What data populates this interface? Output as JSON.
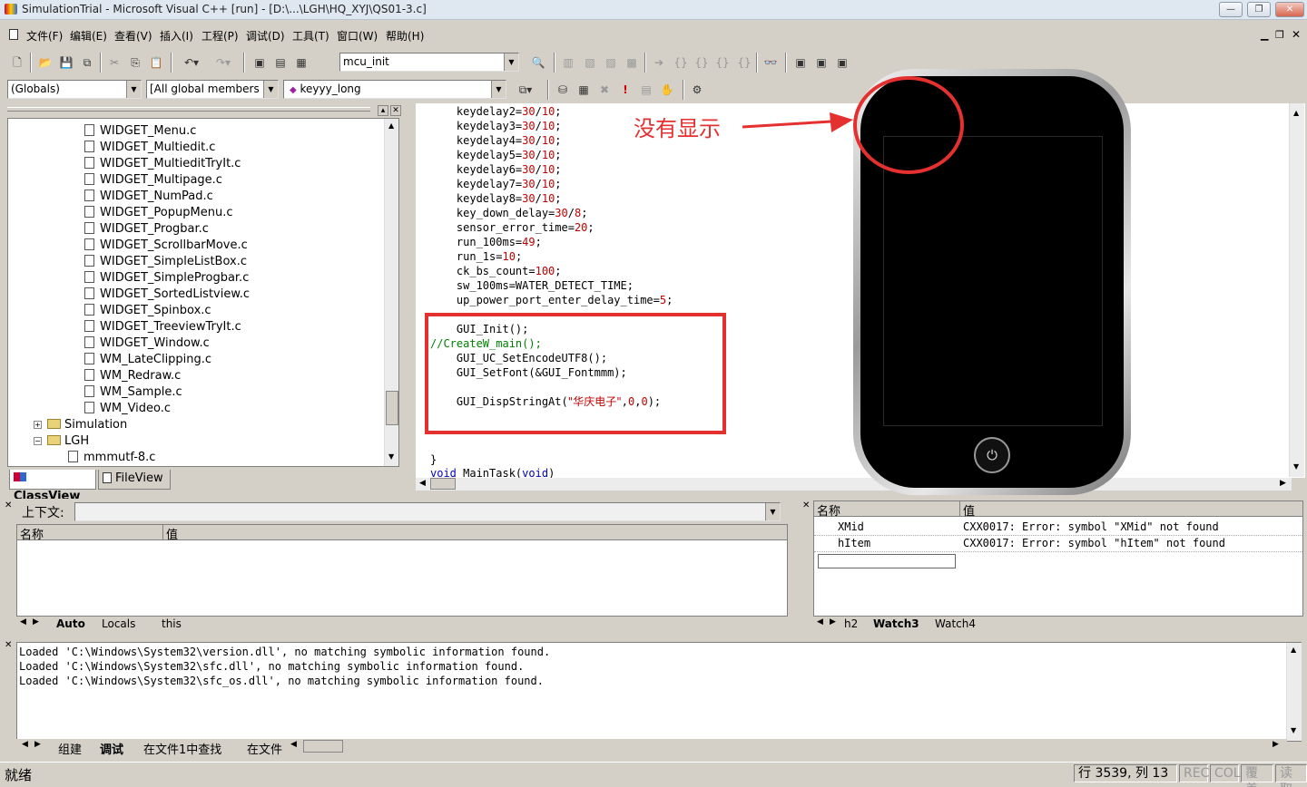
{
  "window": {
    "title": "SimulationTrial - Microsoft Visual C++ [run] - [D:\\...\\LGH\\HQ_XYJ\\QS01-3.c]",
    "min_label": "—",
    "max_label": "❐",
    "close_label": "✕"
  },
  "menu": [
    "文件(F)",
    "编辑(E)",
    "查看(V)",
    "插入(I)",
    "工程(P)",
    "调试(D)",
    "工具(T)",
    "窗口(W)",
    "帮助(H)"
  ],
  "toolbar": {
    "function_combo": "mcu_init",
    "globals_combo": "(Globals)",
    "members_combo": "[All global members",
    "symbol_combo": "keyyy_long"
  },
  "tree": {
    "files": [
      "WIDGET_Menu.c",
      "WIDGET_Multiedit.c",
      "WIDGET_MultieditTryIt.c",
      "WIDGET_Multipage.c",
      "WIDGET_NumPad.c",
      "WIDGET_PopupMenu.c",
      "WIDGET_Progbar.c",
      "WIDGET_ScrollbarMove.c",
      "WIDGET_SimpleListBox.c",
      "WIDGET_SimpleProgbar.c",
      "WIDGET_SortedListview.c",
      "WIDGET_Spinbox.c",
      "WIDGET_TreeviewTryIt.c",
      "WIDGET_Window.c",
      "WM_LateClipping.c",
      "WM_Redraw.c",
      "WM_Sample.c",
      "WM_Video.c"
    ],
    "folder_simulation": "Simulation",
    "folder_lgh": "LGH",
    "file_lgh": "mmmutf-8.c",
    "tab_classview": "ClassView",
    "tab_fileview": "FileView"
  },
  "code": {
    "l1": [
      "    keydelay2=",
      "30",
      "/",
      "10",
      ";"
    ],
    "l2": [
      "    keydelay3=",
      "30",
      "/",
      "10",
      ";"
    ],
    "l3": [
      "    keydelay4=",
      "30",
      "/",
      "10",
      ";"
    ],
    "l4": [
      "    keydelay5=",
      "30",
      "/",
      "10",
      ";"
    ],
    "l5": [
      "    keydelay6=",
      "30",
      "/",
      "10",
      ";"
    ],
    "l6": [
      "    keydelay7=",
      "30",
      "/",
      "10",
      ";"
    ],
    "l7": [
      "    keydelay8=",
      "30",
      "/",
      "10",
      ";"
    ],
    "l8": [
      "    key_down_delay=",
      "30",
      "/",
      "8",
      ";"
    ],
    "l9": [
      "    sensor_error_time=",
      "20",
      ";"
    ],
    "l10": [
      "    run_100ms=",
      "49",
      ";"
    ],
    "l11": [
      "    run_1s=",
      "10",
      ";"
    ],
    "l12": [
      "    ck_bs_count=",
      "100",
      ";"
    ],
    "l13": [
      "    sw_100ms=WATER_DETECT_TIME;"
    ],
    "l14": [
      "    up_power_port_enter_delay_time=",
      "5",
      ";"
    ],
    "l15": [
      "    GUI_Init();"
    ],
    "l16": [
      "//CreateW_main();"
    ],
    "l17": [
      "    GUI_UC_SetEncodeUTF8();"
    ],
    "l18": [
      "    GUI_SetFont(&GUI_Fontmmm);"
    ],
    "l19": [
      "    GUI_DispStringAt(",
      "\"华庆电子\"",
      ",",
      "0",
      ",",
      "0",
      ");"
    ],
    "l20": [
      "}"
    ],
    "l21": [
      "void",
      " MainTask(",
      "void",
      ")"
    ]
  },
  "annotation": {
    "text": "没有显示",
    "color": "#e53030"
  },
  "context_pane": {
    "label": "上下文:",
    "col_name": "名称",
    "col_value": "值",
    "tabs": [
      "Auto",
      "Locals",
      "this"
    ]
  },
  "watch_pane": {
    "col_name": "名称",
    "col_value": "值",
    "rows": [
      {
        "name": "XMid",
        "value": "CXX0017: Error: symbol \"XMid\" not found"
      },
      {
        "name": "hItem",
        "value": "CXX0017: Error: symbol \"hItem\" not found"
      }
    ],
    "tabs": [
      "h2",
      "Watch3",
      "Watch4"
    ]
  },
  "output": {
    "lines": [
      "Loaded 'C:\\Windows\\System32\\version.dll', no matching symbolic information found.",
      "Loaded 'C:\\Windows\\System32\\sfc.dll', no matching symbolic information found.",
      "Loaded 'C:\\Windows\\System32\\sfc_os.dll', no matching symbolic information found."
    ],
    "tabs": [
      "组建",
      "调试",
      "在文件1中查找",
      "在文件"
    ]
  },
  "status": {
    "ready": "就绪",
    "position": "行 3539, 列 13",
    "rec": "REC",
    "col": "COL",
    "ovr": "覆盖",
    "read": "读取"
  }
}
